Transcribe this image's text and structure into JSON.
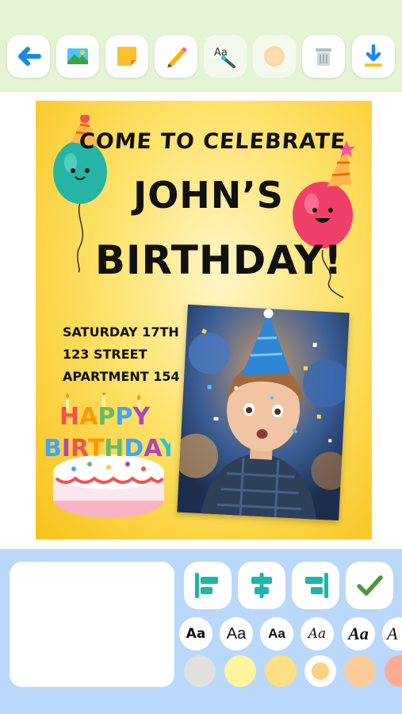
{
  "toolbar": {
    "buttons": [
      {
        "name": "back-button",
        "icon": "arrow-left-icon"
      },
      {
        "name": "image-button",
        "icon": "image-icon"
      },
      {
        "name": "sticker-button",
        "icon": "sticky-note-icon"
      },
      {
        "name": "draw-button",
        "icon": "pencil-icon"
      },
      {
        "name": "text-style-button",
        "icon": "text-brush-icon"
      },
      {
        "name": "stamp-button",
        "icon": "stamp-icon"
      },
      {
        "name": "delete-button",
        "icon": "trash-icon"
      },
      {
        "name": "download-button",
        "icon": "download-icon"
      }
    ]
  },
  "card": {
    "line1": "COME TO CELEBRATE",
    "line2": "JOHN’S",
    "line3": "BIRTHDAY!",
    "details": [
      "SATURDAY 17TH",
      "123 STREET",
      "APARTMENT 154"
    ],
    "cake_text": [
      "HAPPY",
      "BIRTHDAY"
    ],
    "colors": {
      "background": "#fdd835",
      "text": "#111111"
    }
  },
  "editor": {
    "text_input_value": "",
    "font_options": [
      {
        "label": "Aa",
        "style": "bold"
      },
      {
        "label": "Aa",
        "style": "regular"
      },
      {
        "label": "Aa",
        "style": "bold"
      },
      {
        "label": "Aa",
        "style": "script-thin"
      },
      {
        "label": "Aa",
        "style": "script-bold"
      },
      {
        "label": "A",
        "style": "script"
      }
    ],
    "color_swatches": [
      "#e0e0dc",
      "#fff59d",
      "#ffe082",
      "#ffffff",
      "#ffcc99",
      "#ffab91"
    ],
    "selected_swatch": "#ffffff",
    "accent": "#4a9a3a"
  }
}
